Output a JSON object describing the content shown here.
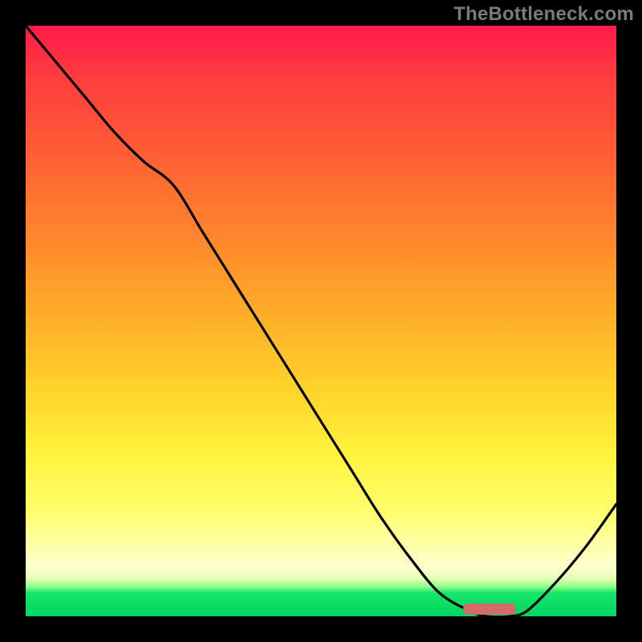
{
  "attribution": "TheBottleneck.com",
  "chart_data": {
    "type": "line",
    "title": "",
    "xlabel": "",
    "ylabel": "",
    "x": [
      0,
      5,
      10,
      15,
      20,
      25,
      30,
      35,
      40,
      45,
      50,
      55,
      60,
      65,
      70,
      75,
      78,
      82,
      85,
      90,
      95,
      100
    ],
    "values": [
      100,
      94,
      88,
      82,
      77,
      73,
      65,
      57,
      49,
      41,
      33,
      25,
      17,
      10,
      4,
      1,
      0,
      0,
      1,
      6,
      12,
      19
    ],
    "ylim": [
      0,
      100
    ],
    "xlim": [
      0,
      100
    ],
    "optimal_marker": {
      "x_start": 74,
      "x_end": 83,
      "y": 0
    },
    "gradient_stops": [
      {
        "pct": 0,
        "color": "#ff1a4a"
      },
      {
        "pct": 30,
        "color": "#ff7e2e"
      },
      {
        "pct": 60,
        "color": "#ffcf2a"
      },
      {
        "pct": 88,
        "color": "#ffffa8"
      },
      {
        "pct": 96,
        "color": "#16e76a"
      },
      {
        "pct": 100,
        "color": "#00d560"
      }
    ]
  }
}
